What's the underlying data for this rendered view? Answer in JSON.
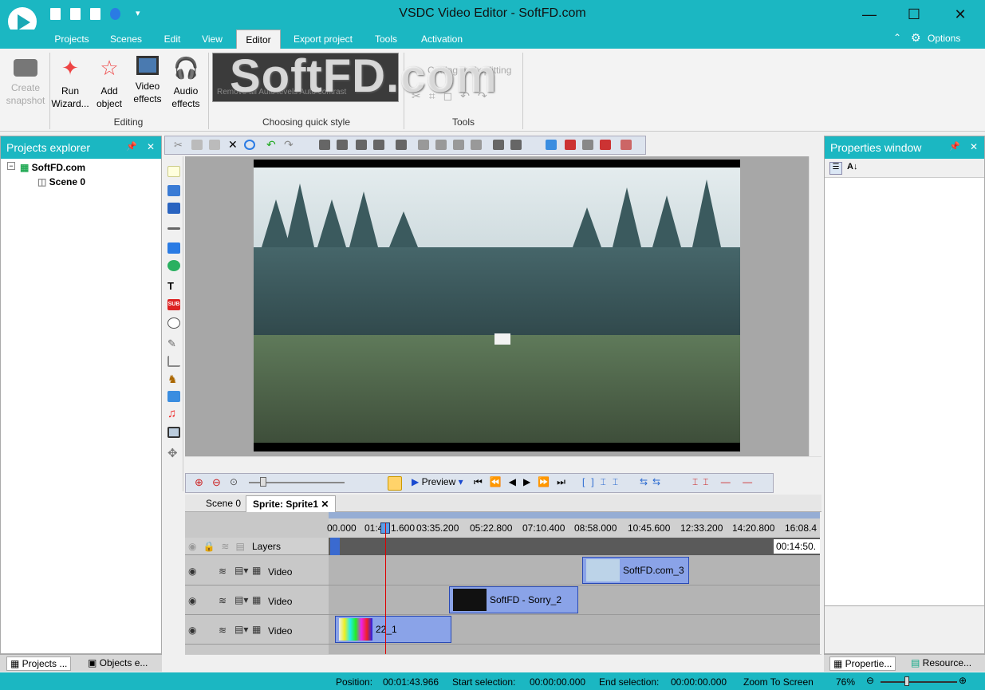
{
  "window": {
    "title": "VSDC Video Editor - SoftFD.com"
  },
  "menu": {
    "items": [
      "Projects",
      "Scenes",
      "Edit",
      "View",
      "Editor",
      "Export project",
      "Tools",
      "Activation"
    ],
    "active": "Editor",
    "options": "Options"
  },
  "ribbon": {
    "create_snapshot": "Create snapshot",
    "run_wizard": "Run Wizard...",
    "add_object": "Add object",
    "video_effects": "Video effects",
    "audio_effects": "Audio effects",
    "group_editing": "Editing",
    "group_quick_style": "Choosing quick style",
    "cutting_splitting": "Cutting and splitting",
    "group_tools": "Tools",
    "quick_style_caption": "Remove all  Auto levels  Auto contrast",
    "watermark": "SoftFD.com"
  },
  "projects_explorer": {
    "title": "Projects explorer",
    "root": "SoftFD.com",
    "child": "Scene 0"
  },
  "properties_window": {
    "title": "Properties window"
  },
  "timeline_toolbar": {
    "preview": "Preview"
  },
  "tabs": {
    "scene": "Scene 0",
    "sprite": "Sprite: Sprite1"
  },
  "timeline": {
    "layers_label": "Layers",
    "ruler": [
      "00.000",
      "01:4",
      "1.600",
      "03:35.200",
      "05:22.800",
      "07:10.400",
      "08:58.000",
      "10:45.600",
      "12:33.200",
      "14:20.800",
      "16:08.4"
    ],
    "end_time": "00:14:50.",
    "tracks": [
      {
        "label": "Video",
        "clip": "SoftFD.com_3"
      },
      {
        "label": "Video",
        "clip": "SoftFD - Sorry_2"
      },
      {
        "label": "Video",
        "clip": "22_1"
      }
    ]
  },
  "bottom_tabs": {
    "left1": "Projects ...",
    "left2": "Objects e...",
    "right1": "Propertie...",
    "right2": "Resource..."
  },
  "status": {
    "position_label": "Position:",
    "position": "00:01:43.966",
    "start_label": "Start selection:",
    "start": "00:00:00.000",
    "end_label": "End selection:",
    "end": "00:00:00.000",
    "zoom_label": "Zoom To Screen",
    "zoom": "76%"
  },
  "colors": {
    "accent": "#1bb7c2",
    "clip": "#8aa3e8",
    "playhead": "#dd0000"
  }
}
